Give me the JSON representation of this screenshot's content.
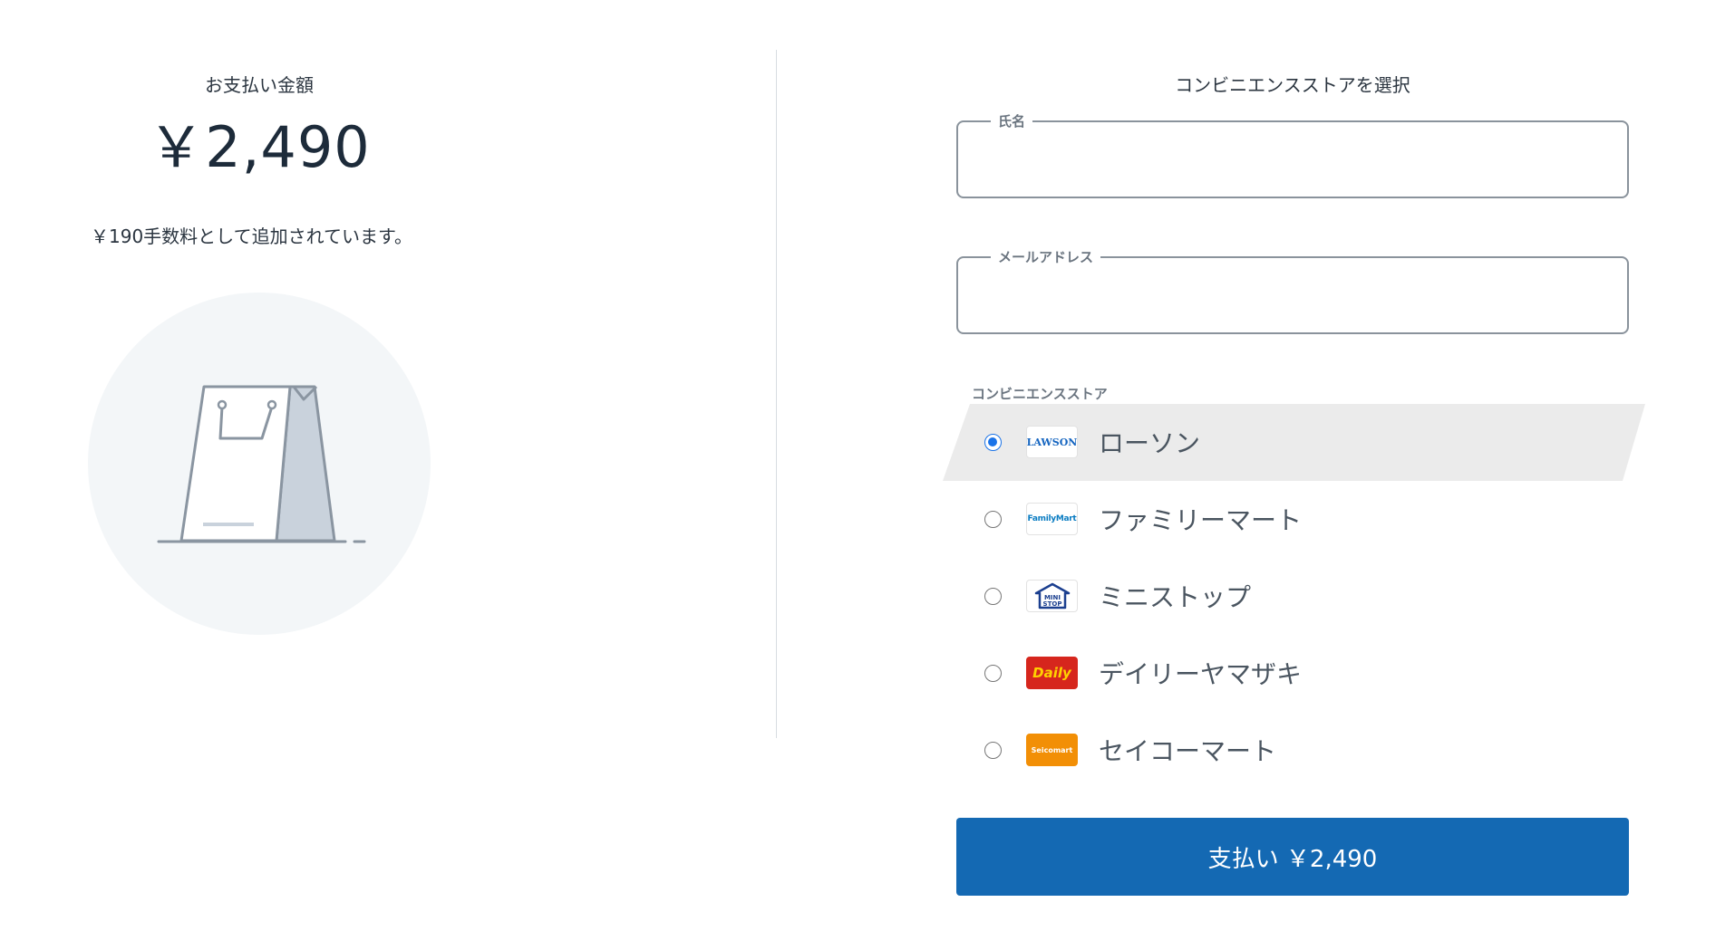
{
  "summary": {
    "amount_label": "お支払い金額",
    "amount": "￥2,490",
    "fee_note": "￥190手数料として追加されています。"
  },
  "form": {
    "title": "コンビニエンスストアを選択",
    "name_label": "氏名",
    "name_value": "",
    "email_label": "メールアドレス",
    "email_value": "",
    "store_group_label": "コンビニエンスストア"
  },
  "stores": [
    {
      "name": "ローソン",
      "logo_text": "LAWSON",
      "selected": true
    },
    {
      "name": "ファミリーマート",
      "logo_text": "FamilyMart",
      "selected": false
    },
    {
      "name": "ミニストップ",
      "logo_text": "MINI STOP",
      "selected": false
    },
    {
      "name": "デイリーヤマザキ",
      "logo_text": "Daily",
      "selected": false
    },
    {
      "name": "セイコーマート",
      "logo_text": "Seicomart",
      "selected": false
    }
  ],
  "pay_button": {
    "label": "支払い ￥2,490"
  },
  "colors": {
    "primary": "#1469b3",
    "radio_selected": "#1a73e8",
    "selected_row_bg": "#ebebeb",
    "illustration_circle": "#f3f6f8"
  }
}
